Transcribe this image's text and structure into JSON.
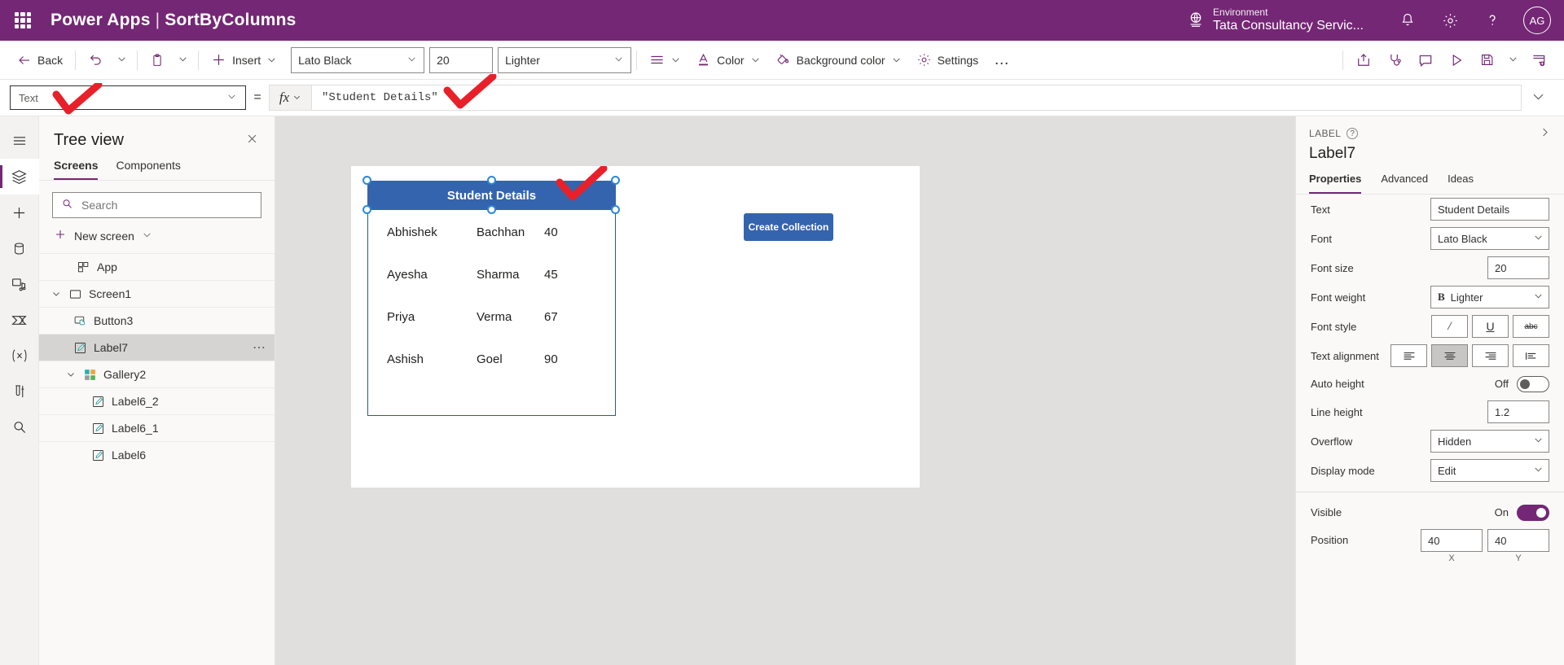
{
  "topbar": {
    "waffle_icon": "app-launcher-icon",
    "product": "Power Apps",
    "separator": "|",
    "app_name": "SortByColumns",
    "environment_label": "Environment",
    "environment_name": "Tata Consultancy Servic...",
    "environment_icon": "globe-icon",
    "notifications_icon": "bell-icon",
    "settings_icon": "gear-icon",
    "help_icon": "question-icon",
    "avatar_initials": "AG",
    "bg_color": "#742774"
  },
  "commandbar": {
    "back": "Back",
    "undo_icon": "undo-icon",
    "paste_icon": "paste-icon",
    "insert": "Insert",
    "font": "Lato Black",
    "font_size": "20",
    "font_weight": "Lighter",
    "align_icon": "align-icon",
    "color": "Color",
    "color_icon": "font-color-icon",
    "background_color": "Background color",
    "background_color_icon": "paint-bucket-icon",
    "settings": "Settings",
    "settings_icon": "gear-icon",
    "overflow": "…",
    "share_icon": "share-icon",
    "checker_icon": "app-checker-icon",
    "comment_icon": "comment-icon",
    "preview_icon": "play-icon",
    "save_icon": "save-icon",
    "publish_icon": "publish-icon"
  },
  "formulabar": {
    "property_value": "Text",
    "equals": "=",
    "fx_label": "fx",
    "formula": "\"Student Details\"",
    "expand_icon": "chevron-down-icon"
  },
  "rail": {
    "items": [
      {
        "name": "hamburger-menu-icon"
      },
      {
        "name": "tree-view-icon",
        "active": true
      },
      {
        "name": "insert-plus-icon"
      },
      {
        "name": "data-cylinder-icon"
      },
      {
        "name": "media-icon"
      },
      {
        "name": "power-automate-icon"
      },
      {
        "name": "variables-icon"
      },
      {
        "name": "app-tests-icon"
      },
      {
        "name": "search-icon"
      }
    ]
  },
  "treeview": {
    "title": "Tree view",
    "close_icon": "close-icon",
    "tabs": [
      {
        "label": "Screens",
        "active": true
      },
      {
        "label": "Components",
        "active": false
      }
    ],
    "search_placeholder": "Search",
    "search_value": "",
    "search_icon": "search-icon",
    "new_screen": "New screen",
    "new_screen_icon": "plus-icon",
    "items": [
      {
        "label": "App",
        "icon": "app-icon",
        "indent": 0,
        "chevron": "",
        "selected": false
      },
      {
        "label": "Screen1",
        "icon": "screen-icon",
        "indent": 0,
        "chevron": "⌄",
        "selected": false
      },
      {
        "label": "Button3",
        "icon": "button-icon",
        "indent": 1,
        "chevron": "",
        "selected": false
      },
      {
        "label": "Label7",
        "icon": "label-icon",
        "indent": 1,
        "chevron": "",
        "selected": true,
        "more": "⋯"
      },
      {
        "label": "Gallery2",
        "icon": "gallery-icon",
        "indent": 1,
        "chevron": "⌄",
        "selected": false
      },
      {
        "label": "Label6_2",
        "icon": "label-icon",
        "indent": 2,
        "chevron": "",
        "selected": false
      },
      {
        "label": "Label6_1",
        "icon": "label-icon",
        "indent": 2,
        "chevron": "",
        "selected": false
      },
      {
        "label": "Label6",
        "icon": "label-icon",
        "indent": 2,
        "chevron": "",
        "selected": false
      }
    ]
  },
  "canvas": {
    "gallery_header": "Student Details",
    "header_bg": "#3464ae",
    "gallery_border": "#2f5597",
    "columns": [
      "first_name",
      "last_name",
      "marks"
    ],
    "rows": [
      {
        "first_name": "Abhishek",
        "last_name": "Bachhan",
        "marks": "40"
      },
      {
        "first_name": "Ayesha",
        "last_name": "Sharma",
        "marks": "45"
      },
      {
        "first_name": "Priya",
        "last_name": "Verma",
        "marks": "67"
      },
      {
        "first_name": "Ashish",
        "last_name": "Goel",
        "marks": "90"
      }
    ],
    "create_collection_button": "Create Collection"
  },
  "properties": {
    "kicker": "LABEL",
    "help_icon": "question-icon",
    "collapse_icon": "chevron-right-icon",
    "control_name": "Label7",
    "tabs": [
      {
        "label": "Properties",
        "active": true
      },
      {
        "label": "Advanced",
        "active": false
      },
      {
        "label": "Ideas",
        "active": false
      }
    ],
    "fields": {
      "text_label": "Text",
      "text_value": "Student Details",
      "font_label": "Font",
      "font_value": "Lato Black",
      "font_size_label": "Font size",
      "font_size_value": "20",
      "font_weight_label": "Font weight",
      "font_weight_value": "Lighter",
      "font_weight_icon": "bold-B-icon",
      "font_style_label": "Font style",
      "font_style_options": [
        "italic-icon",
        "underline-icon",
        "strikethrough-icon"
      ],
      "text_alignment_label": "Text alignment",
      "text_alignment_options": [
        "align-left-icon",
        "align-center-icon",
        "align-right-icon",
        "align-justify-icon"
      ],
      "text_alignment_selected": 1,
      "auto_height_label": "Auto height",
      "auto_height_state": "Off",
      "line_height_label": "Line height",
      "line_height_value": "1.2",
      "overflow_label": "Overflow",
      "overflow_value": "Hidden",
      "display_mode_label": "Display mode",
      "display_mode_value": "Edit",
      "visible_label": "Visible",
      "visible_state": "On",
      "position_label": "Position",
      "position_x": "40",
      "position_y": "40",
      "position_x_axis": "X",
      "position_y_axis": "Y"
    }
  }
}
